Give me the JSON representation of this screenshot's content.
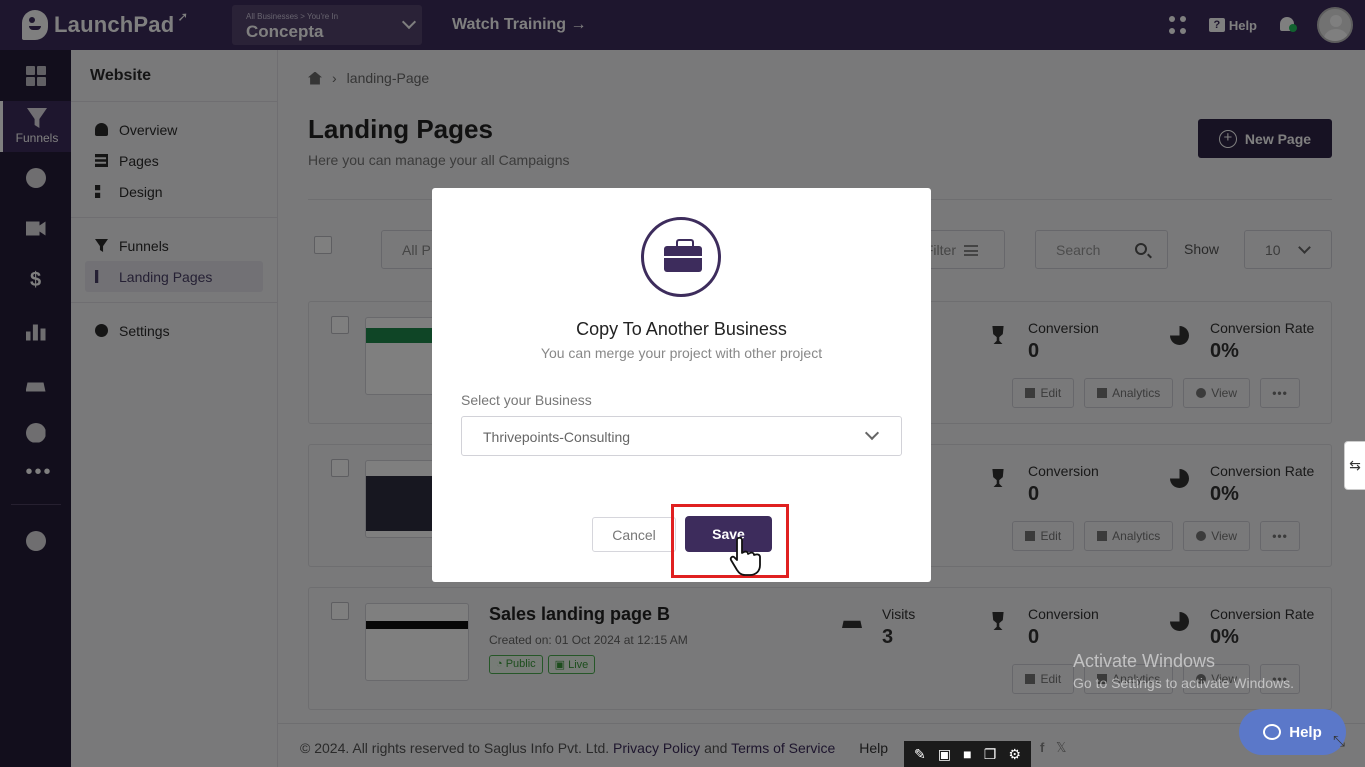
{
  "topbar": {
    "logo_text": "LaunchPad",
    "business_caption": "All Businesses > You're In",
    "business_name": "Concepta",
    "watch_training": "Watch Training →",
    "help_label": "Help"
  },
  "rail": {
    "active_label": "Funnels",
    "icons": [
      "dashboard-icon",
      "funnel-icon",
      "globe-icon",
      "video-icon",
      "dollar-icon",
      "bar-chart-icon",
      "users-icon",
      "gauge-icon",
      "more-icon",
      "gear-icon"
    ]
  },
  "subnav": {
    "title": "Website",
    "group1": [
      "Overview",
      "Pages",
      "Design"
    ],
    "group2": [
      "Funnels",
      "Landing Pages"
    ],
    "group3": [
      "Settings"
    ]
  },
  "main": {
    "breadcrumb": "landing-Page",
    "title": "Landing Pages",
    "subtitle": "Here you can manage your all Campaigns",
    "new_page": "New Page",
    "filter_left": "All P",
    "filter_right": "Filter",
    "search_placeholder": "Search",
    "show_label": "Show",
    "show_value": "10"
  },
  "cards": [
    {
      "conversion_label": "Conversion",
      "conversion": "0",
      "rate_label": "Conversion Rate",
      "rate": "0%"
    },
    {
      "conversion_label": "Conversion",
      "conversion": "0",
      "rate_label": "Conversion Rate",
      "rate": "0%"
    },
    {
      "title": "Sales landing page B",
      "created": "Created on: 01 Oct 2024 at 12:15 AM",
      "badge_public": "Public",
      "badge_live": "Live",
      "visits_label": "Visits",
      "visits": "3",
      "conversion_label": "Conversion",
      "conversion": "0",
      "rate_label": "Conversion Rate",
      "rate": "0%"
    }
  ],
  "actions": {
    "edit": "Edit",
    "analytics": "Analytics",
    "view": "View",
    "more": "•••"
  },
  "footer": {
    "copyright": "©  2024. All rights reserved to Saglus Info Pvt. Ltd.",
    "privacy": "Privacy Policy",
    "and": "and",
    "terms": "Terms of Service",
    "help": "Help"
  },
  "modal": {
    "title": "Copy To Another Business",
    "subtitle": "You can merge your project with other project",
    "field_label": "Select your Business",
    "selected_business": "Thrivepoints-Consulting",
    "cancel": "Cancel",
    "save": "Save"
  },
  "watermark": {
    "line1": "Activate Windows",
    "line2": "Go to Settings to activate Windows."
  },
  "help_fab": "Help"
}
